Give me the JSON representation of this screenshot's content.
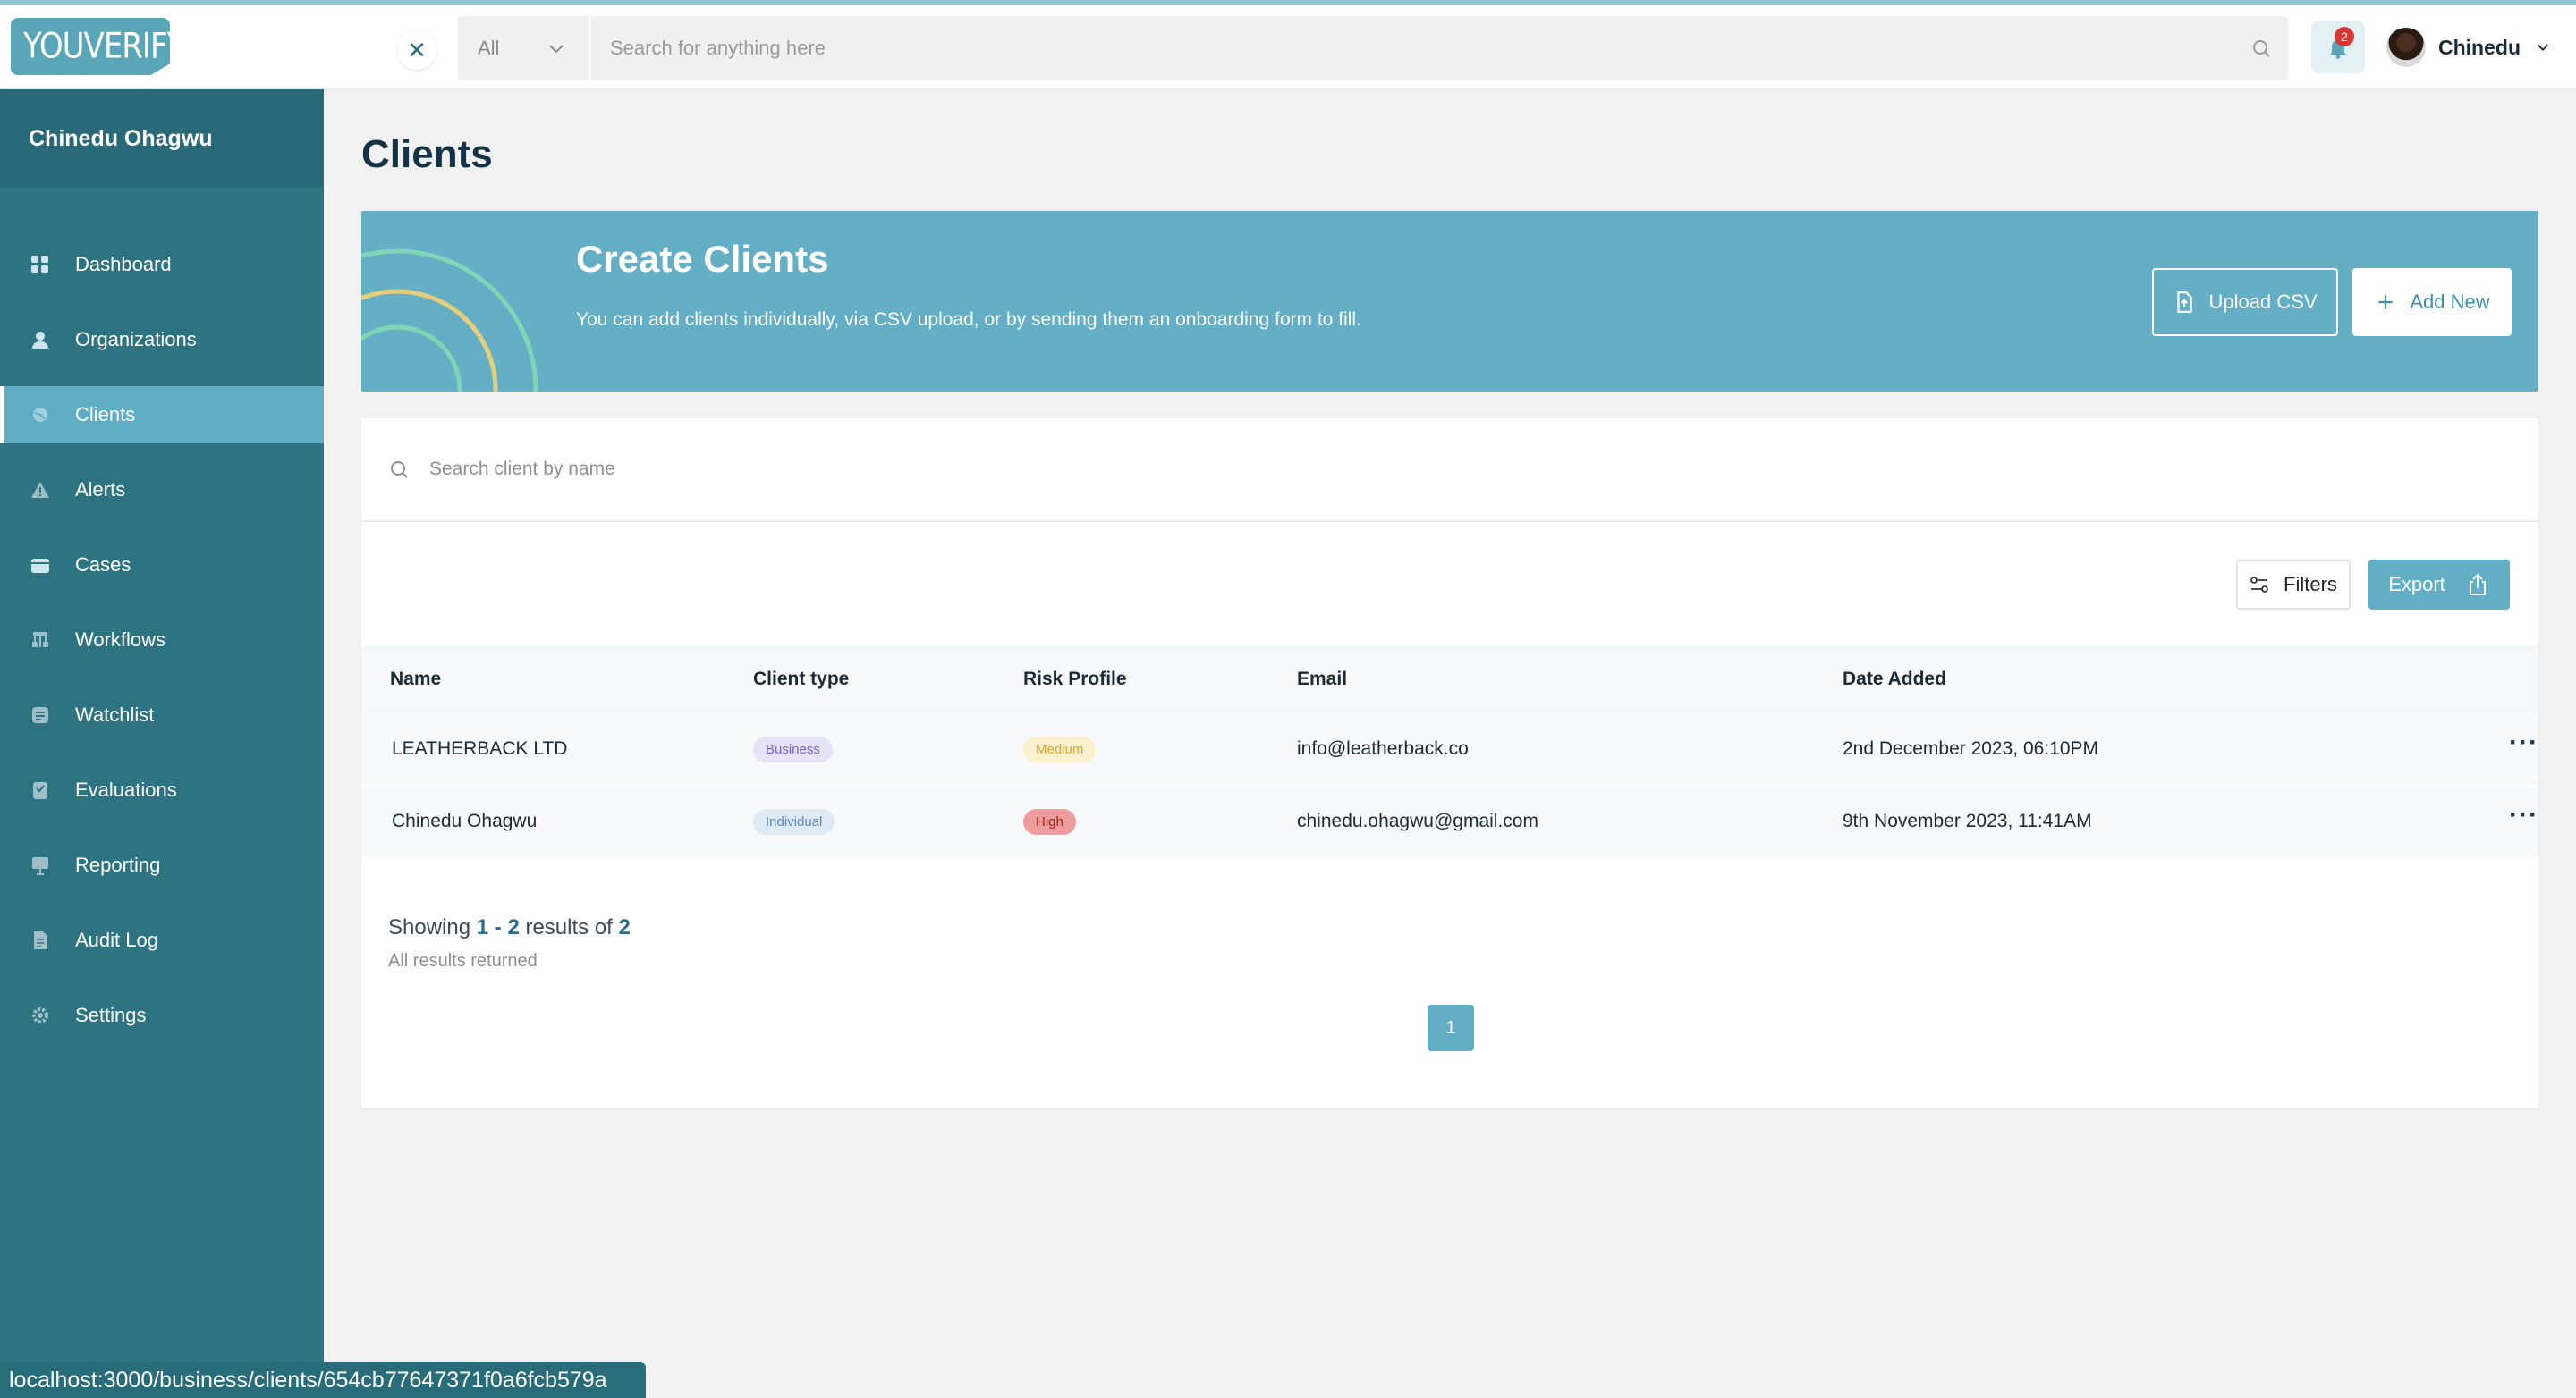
{
  "brand": {
    "logo_text": "YOUVERIFY"
  },
  "topbar": {
    "scope_selected": "All",
    "search_placeholder": "Search for anything here",
    "notification_count": "2",
    "user_name": "Chinedu"
  },
  "sidebar": {
    "org_name": "Chinedu Ohagwu",
    "items": [
      {
        "label": "Dashboard",
        "icon": "grid-icon"
      },
      {
        "label": "Organizations",
        "icon": "person-icon"
      },
      {
        "label": "Clients",
        "icon": "globe-icon",
        "active": true
      },
      {
        "label": "Alerts",
        "icon": "warning-icon"
      },
      {
        "label": "Cases",
        "icon": "folder-icon"
      },
      {
        "label": "Workflows",
        "icon": "workflow-icon"
      },
      {
        "label": "Watchlist",
        "icon": "list-icon"
      },
      {
        "label": "Evaluations",
        "icon": "clipboard-icon"
      },
      {
        "label": "Reporting",
        "icon": "presentation-icon"
      },
      {
        "label": "Audit Log",
        "icon": "document-icon"
      },
      {
        "label": "Settings",
        "icon": "gear-icon"
      }
    ]
  },
  "page": {
    "title": "Clients"
  },
  "banner": {
    "title": "Create Clients",
    "description": "You can add clients individually, via CSV upload, or by sending them an onboarding form to fill.",
    "upload_label": "Upload CSV",
    "add_label": "Add New"
  },
  "clients": {
    "search_placeholder": "Search client by name",
    "filters_label": "Filters",
    "export_label": "Export",
    "columns": [
      "Name",
      "Client type",
      "Risk Profile",
      "Email",
      "Date Added"
    ],
    "rows": [
      {
        "name": "LEATHERBACK LTD",
        "type": "Business",
        "risk": "Medium",
        "email": "info@leatherback.co",
        "date": "2nd December 2023, 06:10PM"
      },
      {
        "name": "Chinedu Ohagwu",
        "type": "Individual",
        "risk": "High",
        "email": "chinedu.ohagwu@gmail.com",
        "date": "9th November 2023, 11:41AM"
      }
    ],
    "row_action": "···",
    "results": {
      "prefix": "Showing",
      "from": "1",
      "sep": "-",
      "to": "2",
      "mid": "results of",
      "total": "2",
      "sub": "All results returned"
    },
    "current_page": "1"
  },
  "status_bar": {
    "url": "localhost:3000/business/clients/654cb77647371f0a6fcb579a"
  },
  "colors": {
    "sidebar": "#2d7381",
    "accent": "#62aec4",
    "banner": "#65afc6",
    "title": "#143245"
  }
}
